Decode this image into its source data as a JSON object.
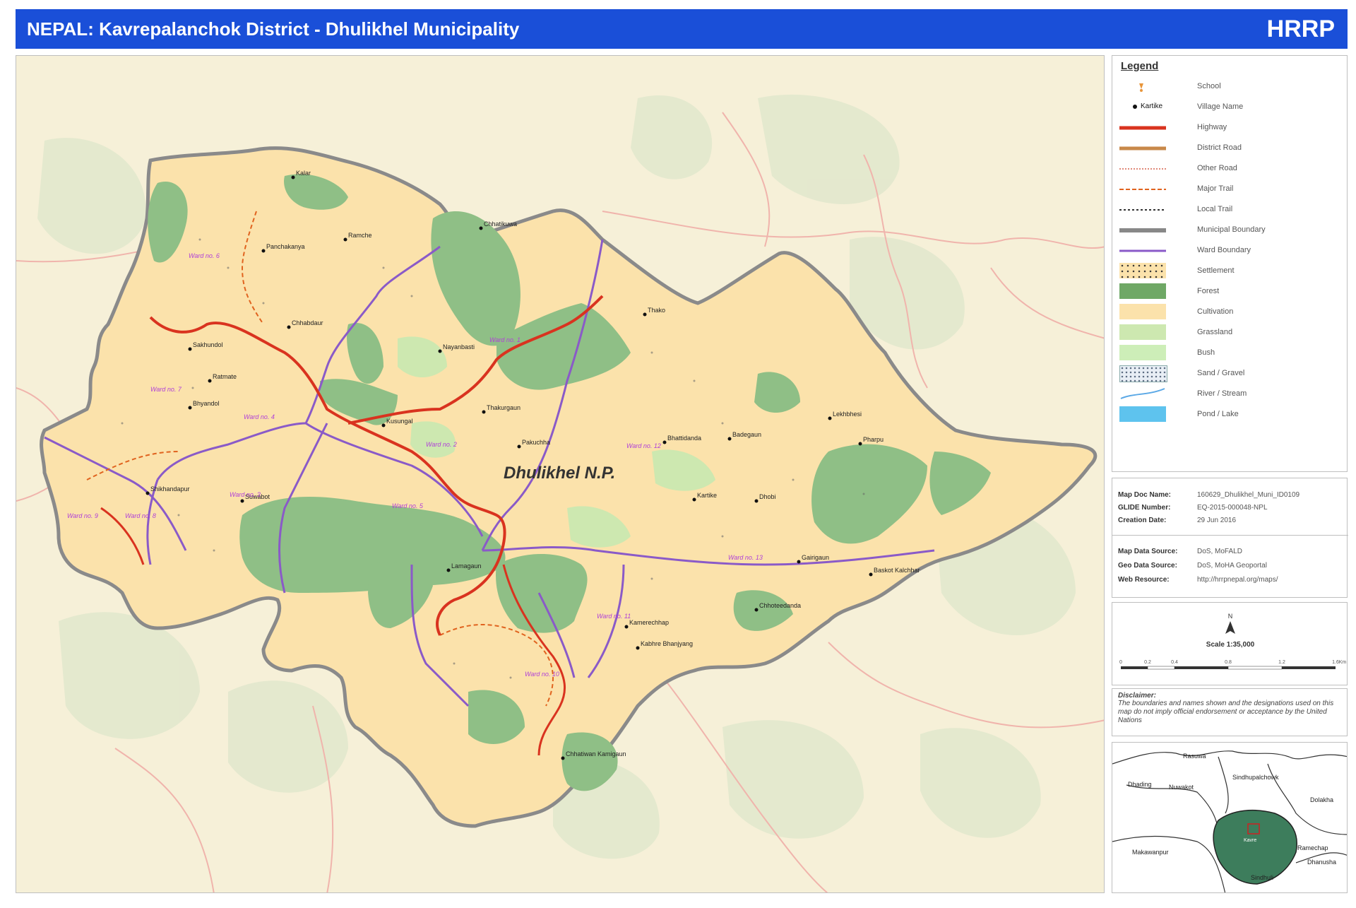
{
  "header": {
    "title": "NEPAL: Kavrepalanchok District - Dhulikhel Municipality",
    "org": "HRRP"
  },
  "map": {
    "main_label": "Dhulikhel N.P.",
    "colors": {
      "background": "#f7f1dc",
      "forest": "#8fbf86",
      "cultivation": "#fbe2ab",
      "bush": "#cde8b0",
      "highway": "#d9331f",
      "boundary": "#888888",
      "ward": "#8a5ac8"
    },
    "villages": [
      {
        "name": "Kalar"
      },
      {
        "name": "Panchakanya"
      },
      {
        "name": "Ramche"
      },
      {
        "name": "Chhatikuwa"
      },
      {
        "name": "Chhabdaur"
      },
      {
        "name": "Sakhundol"
      },
      {
        "name": "Ratmate"
      },
      {
        "name": "Bhyandol"
      },
      {
        "name": "Nayanbasti"
      },
      {
        "name": "Thakurgaun"
      },
      {
        "name": "Kusungal"
      },
      {
        "name": "Pakuchha"
      },
      {
        "name": "Thako"
      },
      {
        "name": "Bhattidanda"
      },
      {
        "name": "Badegaun"
      },
      {
        "name": "Lekhbhesi"
      },
      {
        "name": "Pharpu"
      },
      {
        "name": "Kartike"
      },
      {
        "name": "Dhobi"
      },
      {
        "name": "Shikhandapur"
      },
      {
        "name": "Suwabot"
      },
      {
        "name": "Lamagaun"
      },
      {
        "name": "Kamerechhap"
      },
      {
        "name": "Kabhre Bhanjyang"
      },
      {
        "name": "Gairigaun"
      },
      {
        "name": "Baskot Kalchhar"
      },
      {
        "name": "Chhoteedanda"
      },
      {
        "name": "Chhatiwan Kamigaun"
      }
    ],
    "wards": [
      {
        "name": "Ward no. 1"
      },
      {
        "name": "Ward no. 2"
      },
      {
        "name": "Ward no. 3"
      },
      {
        "name": "Ward no. 4"
      },
      {
        "name": "Ward no. 5"
      },
      {
        "name": "Ward no. 6"
      },
      {
        "name": "Ward no. 7"
      },
      {
        "name": "Ward no. 8"
      },
      {
        "name": "Ward no. 9"
      },
      {
        "name": "Ward no. 10"
      },
      {
        "name": "Ward no. 11"
      },
      {
        "name": "Ward no. 12"
      },
      {
        "name": "Ward no. 13"
      }
    ]
  },
  "legend": {
    "title": "Legend",
    "sample_village": "Kartike",
    "items": [
      {
        "label": "School",
        "icon": "school-icon"
      },
      {
        "label": "Village Name",
        "icon": "village-dot-icon"
      },
      {
        "label": "Highway",
        "color": "#d9331f"
      },
      {
        "label": "District Road",
        "color": "#c8894a"
      },
      {
        "label": "Other Road",
        "color": "#e08a7a"
      },
      {
        "label": "Major Trail",
        "color": "#e0631f"
      },
      {
        "label": "Local Trail",
        "color": "#333333"
      },
      {
        "label": "Municipal Boundary",
        "color": "#888888"
      },
      {
        "label": "Ward Boundary",
        "color": "#8a5ac8"
      },
      {
        "label": "Settlement",
        "color": "#fbe2ab"
      },
      {
        "label": "Forest",
        "color": "#6fa866"
      },
      {
        "label": "Cultivation",
        "color": "#fbe2ab"
      },
      {
        "label": "Grassland",
        "color": "#cde8b0"
      },
      {
        "label": "Bush",
        "color": "#cdeeb8"
      },
      {
        "label": "Sand / Gravel",
        "color": "#e8eef5"
      },
      {
        "label": "River / Stream",
        "color": "#5aa8e6"
      },
      {
        "label": "Pond / Lake",
        "color": "#5ec3ee"
      }
    ]
  },
  "info": {
    "rows": [
      {
        "key": "Map Doc Name:",
        "value": "160629_Dhulikhel_Muni_ID0109"
      },
      {
        "key": "GLIDE Number:",
        "value": "EQ-2015-000048-NPL"
      },
      {
        "key": "Creation Date:",
        "value": "29 Jun 2016"
      },
      {
        "key": "Map Data Source:",
        "value": "DoS, MoFALD"
      },
      {
        "key": "Geo Data Source:",
        "value": "DoS, MoHA Geoportal"
      },
      {
        "key": "Web Resource:",
        "value": "http://hrrpnepal.org/maps/"
      }
    ]
  },
  "scale": {
    "label": "Scale 1:35,000",
    "ticks": [
      "0",
      "0.2",
      "0.4",
      "0.8",
      "1.2",
      "1.6",
      "Km"
    ]
  },
  "disclaimer": {
    "title": "Disclaimer:",
    "body": "The boundaries and names shown and the designations used on this map do not imply official endorsement or acceptance by the United Nations"
  },
  "inset": {
    "districts": [
      "Rasuwa",
      "Dhading",
      "Nuwakot",
      "Sindhupalchowk",
      "Dolakha",
      "Makawanpur",
      "Kavre",
      "Ramechap",
      "Dhanusha",
      "Sindhuli"
    ]
  }
}
